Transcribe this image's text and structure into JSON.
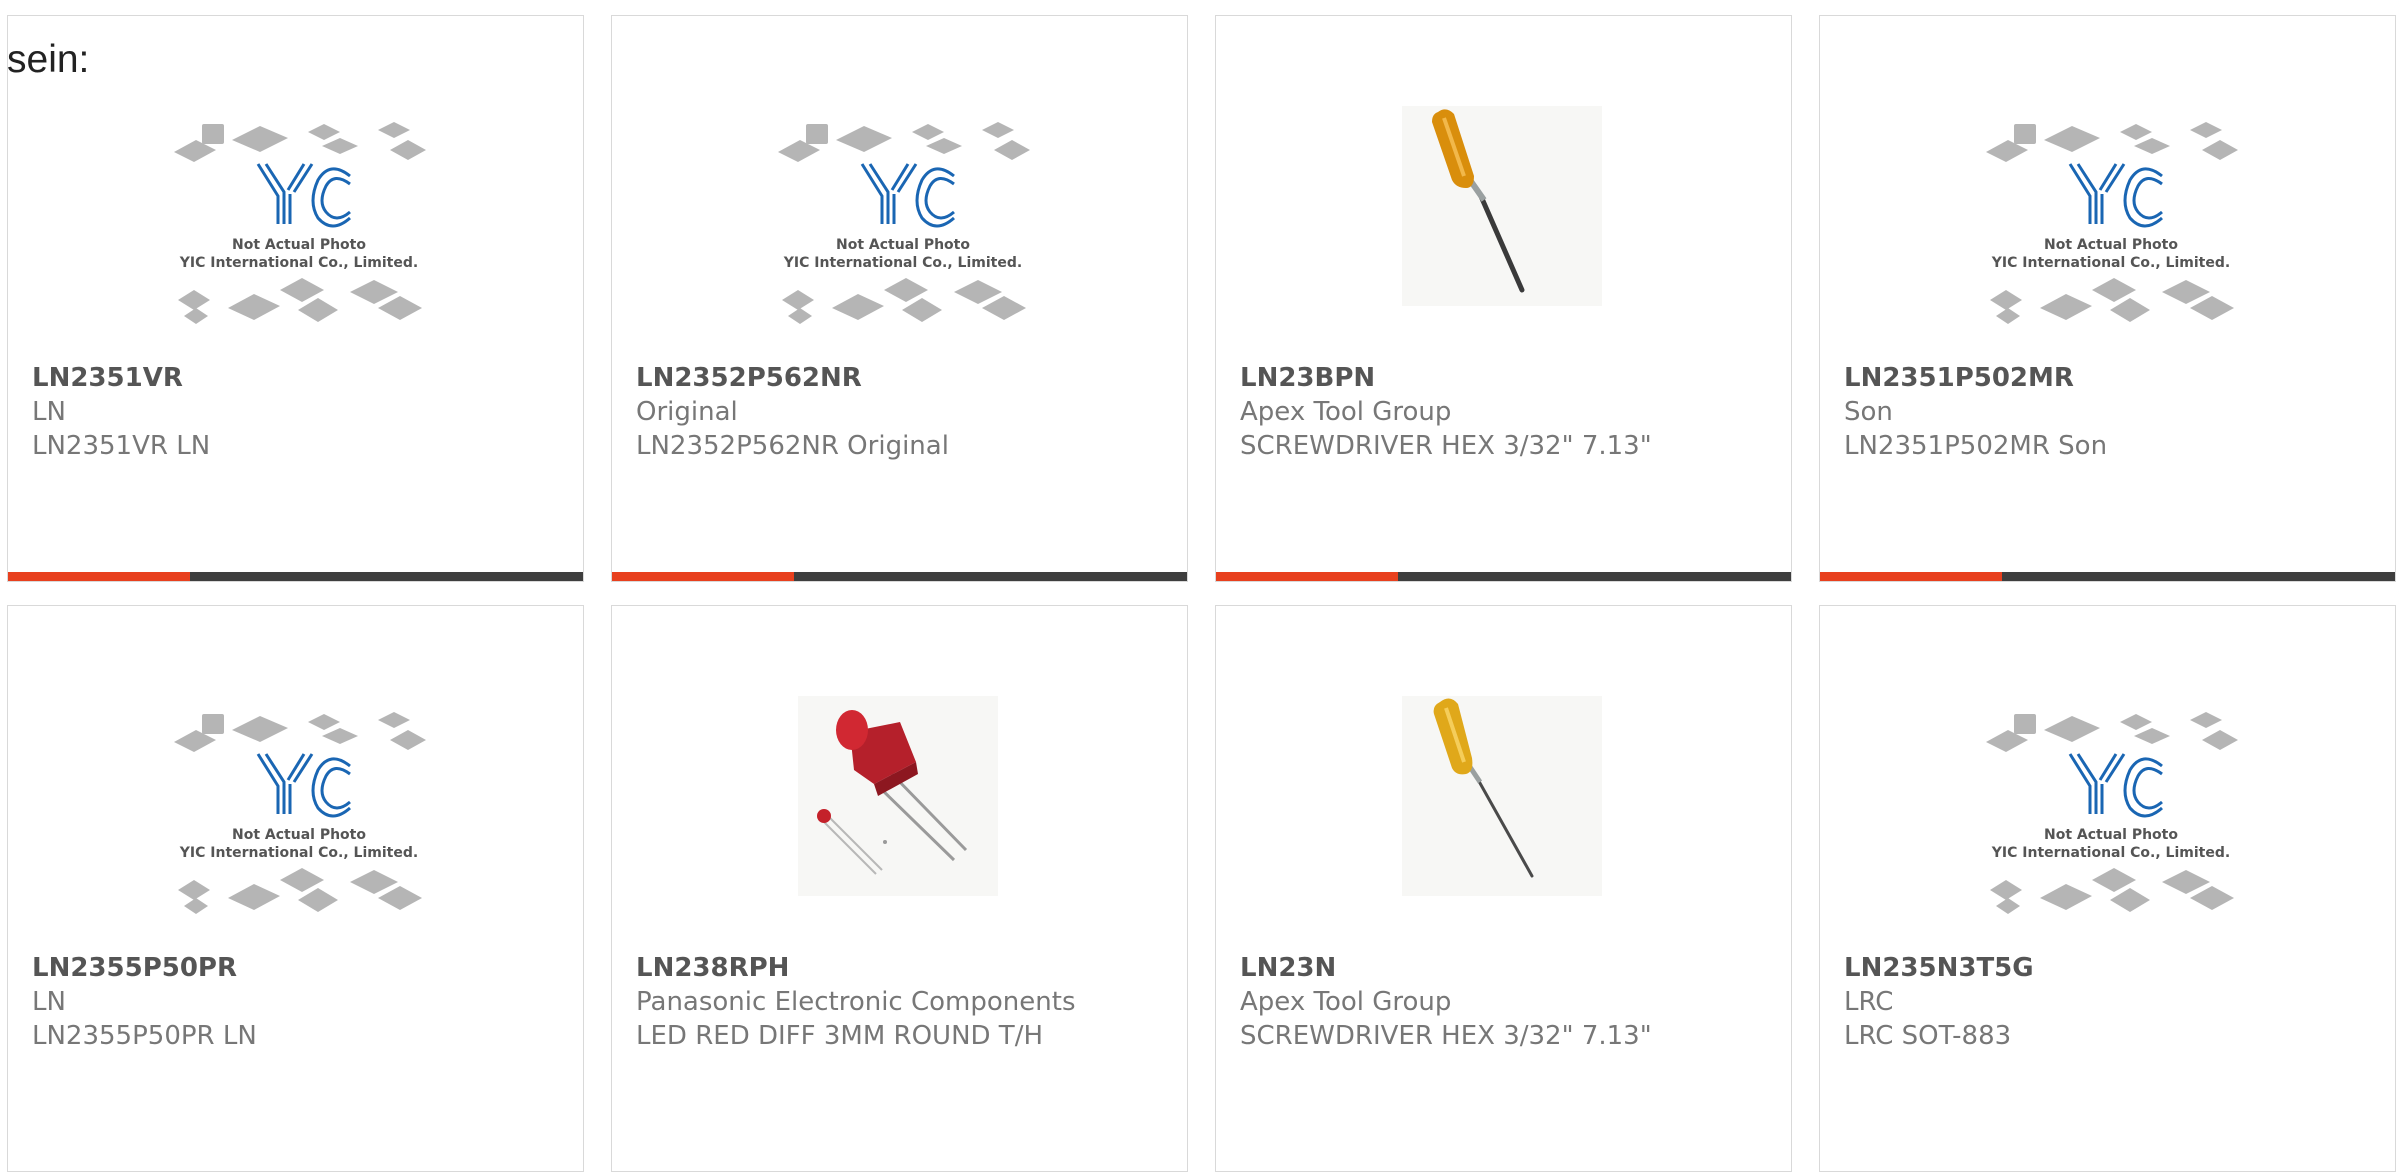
{
  "page": {
    "label": "sein:"
  },
  "placeholder": {
    "line1": "Not Actual Photo",
    "line2": "YIC International Co., Limited."
  },
  "colors": {
    "accent": "#e8401e",
    "bar": "#3e3e3e",
    "logo": "#1a66b3"
  },
  "products": [
    {
      "pn": "LN2351VR",
      "maker": "LN",
      "desc": "LN2351VR LN",
      "image": "placeholder-icon"
    },
    {
      "pn": "LN2352P562NR",
      "maker": "Original",
      "desc": "LN2352P562NR Original",
      "image": "placeholder-icon"
    },
    {
      "pn": "LN23BPN",
      "maker": "Apex Tool Group",
      "desc": "SCREWDRIVER HEX 3/32\" 7.13\"",
      "image": "screwdriver-icon"
    },
    {
      "pn": "LN2351P502MR",
      "maker": "Son",
      "desc": "LN2351P502MR Son",
      "image": "placeholder-icon"
    },
    {
      "pn": "LN2355P50PR",
      "maker": "LN",
      "desc": "LN2355P50PR LN",
      "image": "placeholder-icon"
    },
    {
      "pn": "LN238RPH",
      "maker": "Panasonic Electronic Components",
      "desc": "LED RED DIFF 3MM ROUND T/H",
      "image": "led-icon"
    },
    {
      "pn": "LN23N",
      "maker": "Apex Tool Group",
      "desc": "SCREWDRIVER HEX 3/32\" 7.13\"",
      "image": "screwdriver-icon"
    },
    {
      "pn": "LN235N3T5G",
      "maker": "LRC",
      "desc": "LRC SOT-883",
      "image": "placeholder-icon"
    }
  ]
}
